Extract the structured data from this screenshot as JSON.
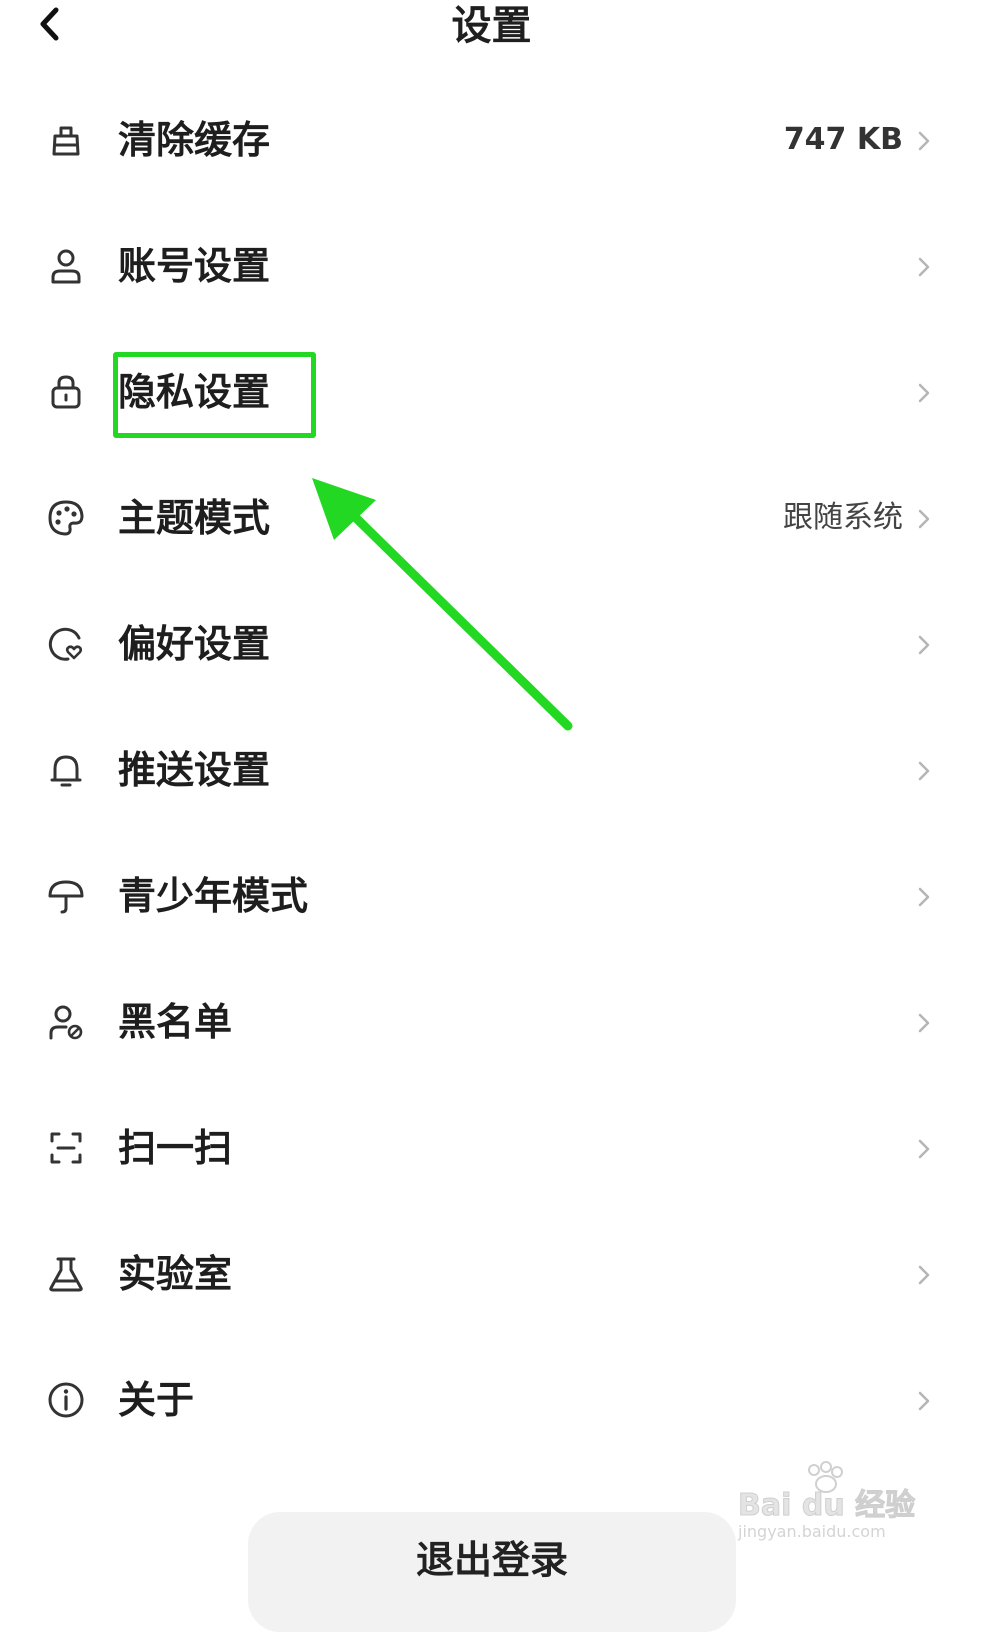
{
  "header": {
    "title": "设置"
  },
  "rows": [
    {
      "label": "清除缓存",
      "value": "747 KB",
      "icon": "broom-icon"
    },
    {
      "label": "账号设置",
      "value": "",
      "icon": "user-icon"
    },
    {
      "label": "隐私设置",
      "value": "",
      "icon": "lock-icon"
    },
    {
      "label": "主题模式",
      "value": "跟随系统",
      "icon": "palette-icon"
    },
    {
      "label": "偏好设置",
      "value": "",
      "icon": "preference-icon"
    },
    {
      "label": "推送设置",
      "value": "",
      "icon": "bell-icon"
    },
    {
      "label": "青少年模式",
      "value": "",
      "icon": "umbrella-icon"
    },
    {
      "label": "黑名单",
      "value": "",
      "icon": "user-block-icon"
    },
    {
      "label": "扫一扫",
      "value": "",
      "icon": "scan-icon"
    },
    {
      "label": "实验室",
      "value": "",
      "icon": "flask-icon"
    },
    {
      "label": "关于",
      "value": "",
      "icon": "info-icon"
    }
  ],
  "logout": {
    "label": "退出登录"
  },
  "watermark": {
    "brand": "Bai du 经验",
    "url": "jingyan.baidu.com"
  },
  "colors": {
    "annotation": "#22d822",
    "chevron": "#b5b5b5",
    "icon": "#333333"
  }
}
